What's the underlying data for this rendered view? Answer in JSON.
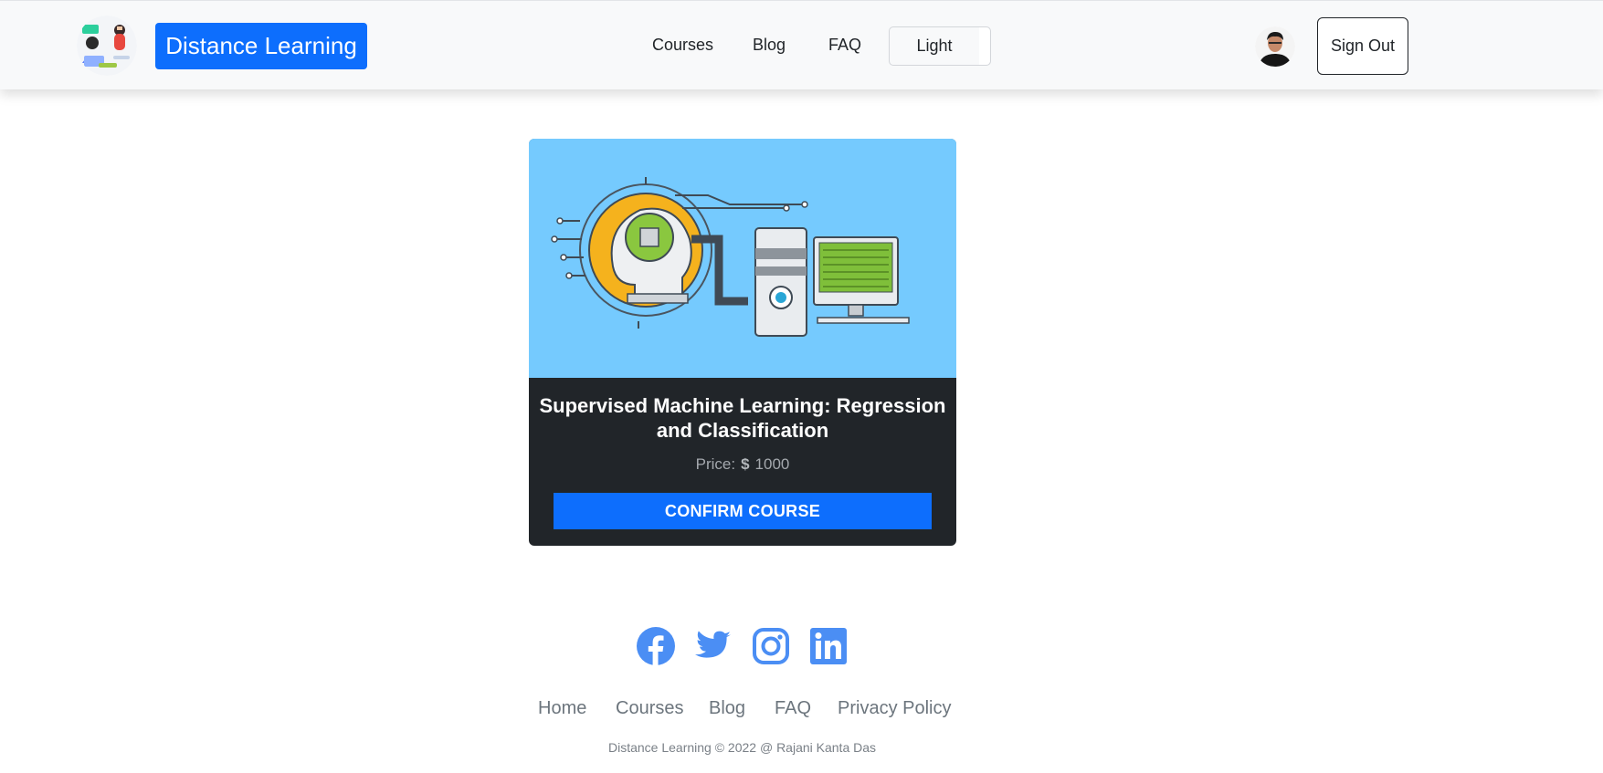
{
  "brand": {
    "name": "Distance Learning",
    "logo_icon": "teacher-student-logo",
    "accent": "#0d6efd"
  },
  "nav": {
    "links": [
      "Courses",
      "Blog",
      "FAQ"
    ],
    "theme_toggle": "Light",
    "avatar_icon": "user-avatar",
    "sign_out": "Sign Out"
  },
  "course": {
    "image_icon": "machine-learning-illustration",
    "title": "Supervised Machine Learning: Regression and Classification",
    "price_label": "Price:",
    "price_currency_icon": "dollar-icon",
    "price_value": "1000",
    "confirm_label": "CONFIRM COURSE",
    "card_bg": "#212529",
    "image_bg": "#75cafe"
  },
  "footer": {
    "social_icons": [
      "facebook-icon",
      "twitter-icon",
      "instagram-icon",
      "linkedin-icon"
    ],
    "social_color": "#4b8ef4",
    "links": [
      "Home",
      "Courses",
      "Blog",
      "FAQ",
      "Privacy Policy"
    ],
    "copyright": "Distance Learning © 2022 @ Rajani Kanta Das"
  }
}
